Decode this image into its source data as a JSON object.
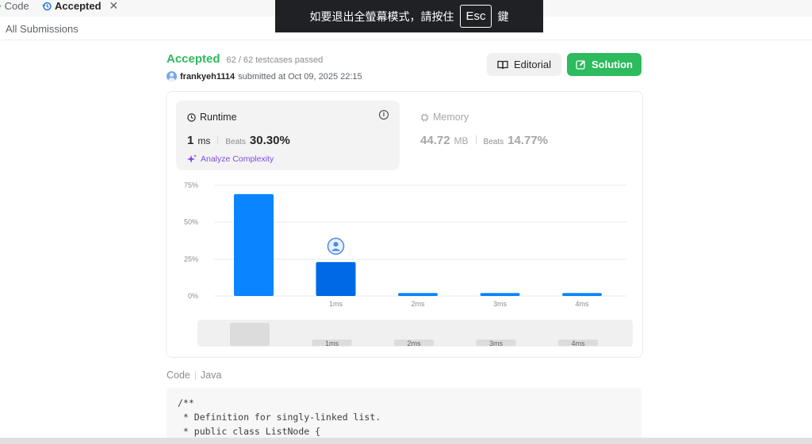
{
  "tabs": {
    "code_label": "Code",
    "accepted_label": "Accepted",
    "close_glyph": "✕"
  },
  "fullscreen_banner": {
    "text_before": "如要退出全螢幕模式，請按住",
    "key": "Esc",
    "text_after": "鍵"
  },
  "subheader": {
    "all_submissions": "All Submissions"
  },
  "submission": {
    "status": "Accepted",
    "testcases": "62 / 62 testcases passed",
    "username": "frankyeh1114",
    "submitted_text": "submitted at Oct 09, 2025 22:15"
  },
  "buttons": {
    "editorial": "Editorial",
    "solution": "Solution"
  },
  "runtime": {
    "label": "Runtime",
    "value": "1",
    "unit": "ms",
    "beats_label": "Beats",
    "beats_value": "30.30%",
    "analyze": "Analyze Complexity"
  },
  "memory": {
    "label": "Memory",
    "value": "44.72",
    "unit": "MB",
    "beats_label": "Beats",
    "beats_value": "14.77%"
  },
  "chart_data": {
    "type": "bar",
    "categories": [
      "",
      "1ms",
      "2ms",
      "3ms",
      "4ms"
    ],
    "values": [
      69,
      23,
      2,
      2,
      2
    ],
    "highlight_index": 1,
    "y_ticks": [
      "0%",
      "25%",
      "50%",
      "75%"
    ],
    "ylim": [
      0,
      75
    ],
    "grid": true,
    "minimap_labels": [
      "",
      "1ms",
      "2ms",
      "3ms",
      "4ms"
    ],
    "colors": {
      "bar": "#0a84ff",
      "highlight": "#0069e6",
      "grid": "#ececec",
      "minimap_bg": "#f0f0f0",
      "minimap_sel": "#dcdcdc"
    }
  },
  "code": {
    "label": "Code",
    "language": "Java",
    "lines": [
      "/**",
      " * Definition for singly-linked list.",
      " * public class ListNode {"
    ]
  },
  "colors": {
    "accent_green": "#2cbb5d",
    "purple": "#7d4ce0",
    "dark_banner": "#202124"
  }
}
